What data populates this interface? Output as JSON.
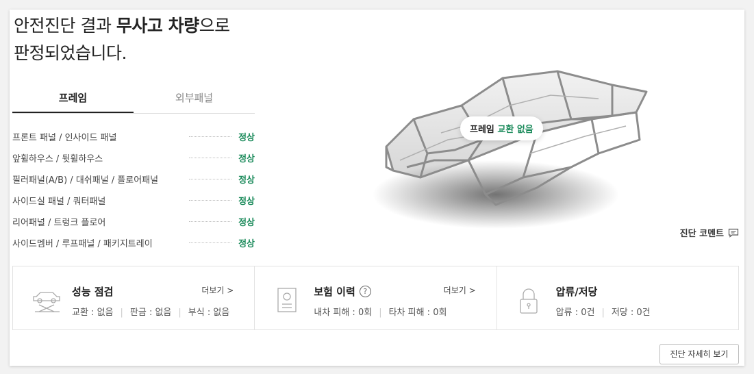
{
  "headline": {
    "line1_prefix": "안전진단 결과 ",
    "line1_bold": "무사고 차량",
    "line1_suffix": "으로",
    "line2": "판정되었습니다."
  },
  "tabs": [
    {
      "label": "프레임",
      "active": true
    },
    {
      "label": "외부패널",
      "active": false
    }
  ],
  "items": [
    {
      "label": "프론트 패널 / 인사이드 패널",
      "status": "정상"
    },
    {
      "label": "앞휠하우스 / 뒷휠하우스",
      "status": "정상"
    },
    {
      "label": "필러패널(A/B) / 대쉬패널 / 플로어패널",
      "status": "정상"
    },
    {
      "label": "사이드실 패널 / 쿼터패널",
      "status": "정상"
    },
    {
      "label": "리어패널 / 트렁크 플로어",
      "status": "정상"
    },
    {
      "label": "사이드멤버 / 루프패널 / 패키지트레이",
      "status": "정상"
    }
  ],
  "car_badge": {
    "prefix": "프레임 ",
    "highlight": "교환 없음"
  },
  "comment_link": "진단 코멘트",
  "info_boxes": {
    "performance": {
      "title": "성능 점검",
      "more": "더보기 >",
      "line": {
        "a": "교환 : 없음",
        "b": "판금 : 없음",
        "c": "부식 : 없음"
      }
    },
    "insurance": {
      "title": "보험 이력",
      "help": "?",
      "more": "더보기 >",
      "line": {
        "a": "내차 피해 : 0회",
        "b": "타차 피해 : 0회"
      }
    },
    "lien": {
      "title": "압류/저당",
      "line": {
        "a": "압류 : 0건",
        "b": "저당 : 0건"
      }
    }
  },
  "detail_button": "진단 자세히 보기",
  "colors": {
    "accent_green": "#1a8a5a"
  }
}
